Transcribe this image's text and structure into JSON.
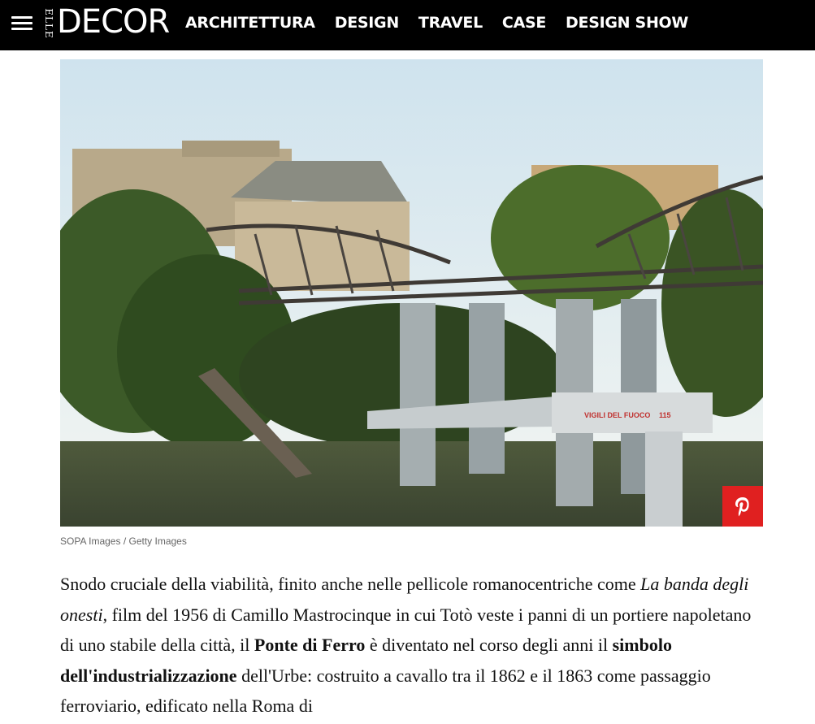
{
  "header": {
    "logo_small": "ELLE",
    "logo_main": "DECOR",
    "nav": [
      {
        "label": "ARCHITETTURA"
      },
      {
        "label": "DESIGN"
      },
      {
        "label": "TRAVEL"
      },
      {
        "label": "CASE"
      },
      {
        "label": "DESIGN SHOW"
      }
    ]
  },
  "photo": {
    "sign_text": "VIGILI DEL FUOCO",
    "sign_number": "115",
    "credit": "SOPA Images / Getty Images"
  },
  "article": {
    "p1": "Snodo cruciale della viabilità, finito anche nelle pellicole romanocentriche come ",
    "p1_film": "La banda degli onesti",
    "p2": ", film del 1956 di Camillo Mastrocinque in cui Totò veste i panni di un portiere napoletano di uno stabile della città, il ",
    "p2_bold": "Ponte di Ferro",
    "p3": " è diventato nel corso degli anni il ",
    "p3_bold": "simbolo dell'industrializzazione",
    "p4": " dell'Urbe: costruito a cavallo tra il 1862 e il 1863 come passaggio ferroviario, edificato nella Roma di"
  },
  "colors": {
    "topbar": "#000000",
    "pin_button": "#e02020"
  }
}
